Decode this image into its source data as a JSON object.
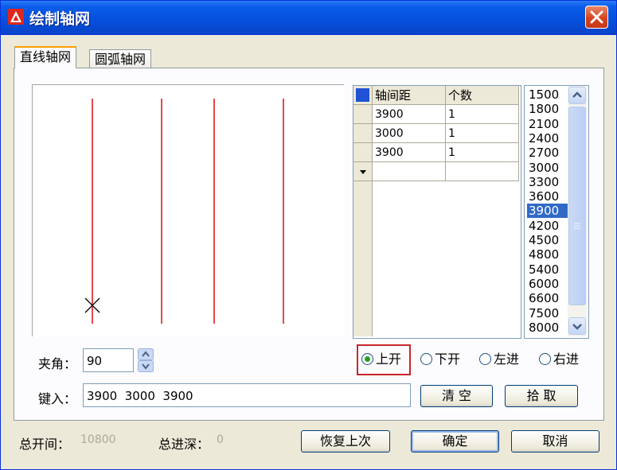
{
  "window": {
    "title": "绘制轴网"
  },
  "tabs": [
    {
      "label": "直线轴网"
    },
    {
      "label": "圆弧轴网"
    }
  ],
  "preview": {
    "axis_count": 4,
    "axis_color": "#dd1c1c"
  },
  "grid": {
    "headers": [
      "轴间距",
      "个数"
    ],
    "rows": [
      {
        "spacing": "3900",
        "count": "1"
      },
      {
        "spacing": "3000",
        "count": "1"
      },
      {
        "spacing": "3900",
        "count": "1"
      },
      {
        "spacing": "",
        "count": ""
      }
    ]
  },
  "spacing_list": {
    "items": [
      "1500",
      "1800",
      "2100",
      "2400",
      "2700",
      "3000",
      "3300",
      "3600",
      "3900",
      "4200",
      "4500",
      "4800",
      "5400",
      "6000",
      "6600",
      "7500",
      "8000"
    ],
    "selected": "3900"
  },
  "angle": {
    "label": "夹角：",
    "value": "90"
  },
  "input": {
    "label": "键入：",
    "value": "3900  3000  3900"
  },
  "radios": [
    {
      "label": "上开",
      "checked": true
    },
    {
      "label": "下开",
      "checked": false
    },
    {
      "label": "左进",
      "checked": false
    },
    {
      "label": "右进",
      "checked": false
    }
  ],
  "buttons": {
    "clear": "清  空",
    "pick": "拾  取",
    "restore": "恢复上次",
    "ok": "确定",
    "cancel": "取消"
  },
  "footer": {
    "total_open_label": "总开间：",
    "total_open_value": "10800",
    "total_depth_label": "总进深：",
    "total_depth_value": "0"
  }
}
